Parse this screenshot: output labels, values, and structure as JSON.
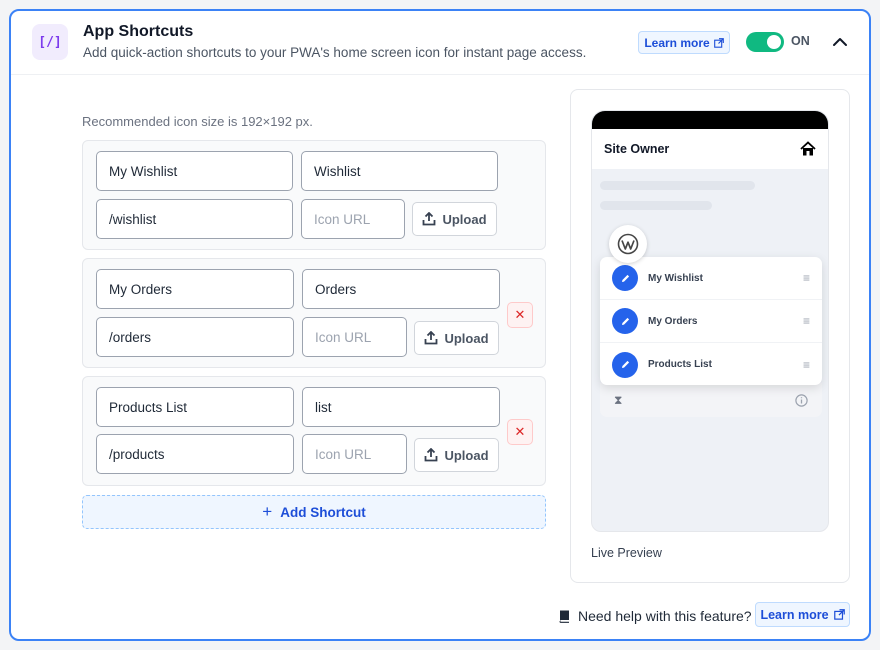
{
  "header": {
    "icon_text": "[/]",
    "title": "App Shortcuts",
    "subtitle": "Add quick-action shortcuts to your PWA's home screen icon for instant page access.",
    "learn_more": "Learn more",
    "toggle_label": "ON",
    "toggle_on": true
  },
  "recommend_note": "Recommended icon size is 192×192 px.",
  "shortcuts": [
    {
      "name": "My Wishlist",
      "short_name": "Wishlist",
      "url": "/wishlist",
      "icon_placeholder": "Icon URL",
      "upload_label": "Upload",
      "removable": false
    },
    {
      "name": "My Orders",
      "short_name": "Orders",
      "url": "/orders",
      "icon_placeholder": "Icon URL",
      "upload_label": "Upload",
      "removable": true
    },
    {
      "name": "Products List",
      "short_name": "list",
      "url": "/products",
      "icon_placeholder": "Icon URL",
      "upload_label": "Upload",
      "removable": true
    }
  ],
  "add_shortcut": "Add Shortcut",
  "preview": {
    "site_title": "Site Owner",
    "menu_items": [
      "My Wishlist",
      "My Orders",
      "Products List"
    ],
    "caption": "Live Preview"
  },
  "footer": {
    "help_text": "Need help with this feature?",
    "learn_more": "Learn more"
  },
  "colors": {
    "accent": "#3b82f6",
    "toggle": "#10b981",
    "link": "#1d4ed8",
    "danger": "#dc2626",
    "purple": "#7c3aed"
  }
}
